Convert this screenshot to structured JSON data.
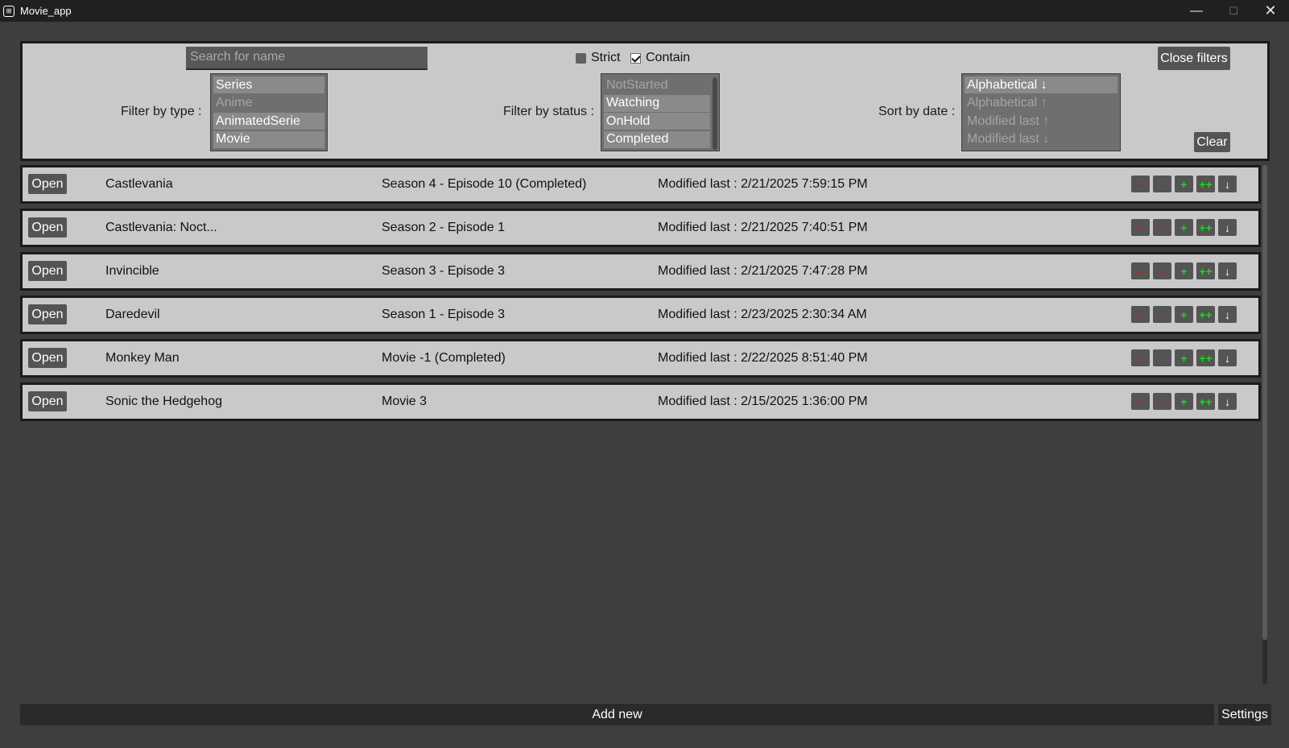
{
  "window": {
    "title": "Movie_app",
    "minimize": "—",
    "maximize": "☐",
    "close": "✕"
  },
  "filters": {
    "search_placeholder": "Search for name",
    "strict_label": "Strict",
    "strict_checked": false,
    "contain_label": "Contain",
    "contain_checked": true,
    "close_filters_label": "Close filters",
    "clear_label": "Clear",
    "type_label": "Filter by type :",
    "type_options": [
      {
        "label": "Series",
        "selected": true
      },
      {
        "label": "Anime",
        "selected": false
      },
      {
        "label": "AnimatedSerie",
        "selected": true
      },
      {
        "label": "Movie",
        "selected": true
      }
    ],
    "status_label": "Filter by status :",
    "status_options": [
      {
        "label": "NotStarted",
        "selected": false
      },
      {
        "label": "Watching",
        "selected": true
      },
      {
        "label": "OnHold",
        "selected": true
      },
      {
        "label": "Completed",
        "selected": true
      }
    ],
    "sort_label": "Sort by date :",
    "sort_options": [
      {
        "label": "Alphabetical ↓",
        "selected": true
      },
      {
        "label": "Alphabetical ↑",
        "selected": false
      },
      {
        "label": "Modified last ↑",
        "selected": false
      },
      {
        "label": "Modified last ↓",
        "selected": false
      }
    ]
  },
  "entries": [
    {
      "open": "Open",
      "name": "Castlevania",
      "progress": "Season 4 - Episode 10 (Completed)",
      "modified": "Modified last : 2/21/2025 7:59:15 PM"
    },
    {
      "open": "Open",
      "name": "Castlevania: Noct...",
      "progress": "Season 2 - Episode 1",
      "modified": "Modified last : 2/21/2025 7:40:51 PM"
    },
    {
      "open": "Open",
      "name": "Invincible",
      "progress": "Season 3 - Episode 3",
      "modified": "Modified last : 2/21/2025 7:47:28 PM"
    },
    {
      "open": "Open",
      "name": "Daredevil",
      "progress": "Season 1 - Episode 3",
      "modified": "Modified last : 2/23/2025 2:30:34 AM"
    },
    {
      "open": "Open",
      "name": "Monkey Man",
      "progress": "Movie -1 (Completed)",
      "modified": "Modified last : 2/22/2025 8:51:40 PM"
    },
    {
      "open": "Open",
      "name": "Sonic the Hedgehog",
      "progress": "Movie 3",
      "modified": "Modified last : 2/15/2025 1:36:00 PM"
    }
  ],
  "row_controls": {
    "decrement_big": "--",
    "decrement": "-",
    "increment": "+",
    "increment_big": "++",
    "expand": "↓"
  },
  "footer": {
    "add_new_label": "Add new",
    "settings_label": "Settings"
  },
  "colors": {
    "background": "#3e3e3e",
    "panel": "#c9c9c9",
    "button": "#545454",
    "minus": "#d21a1a",
    "plus": "#22d322"
  }
}
